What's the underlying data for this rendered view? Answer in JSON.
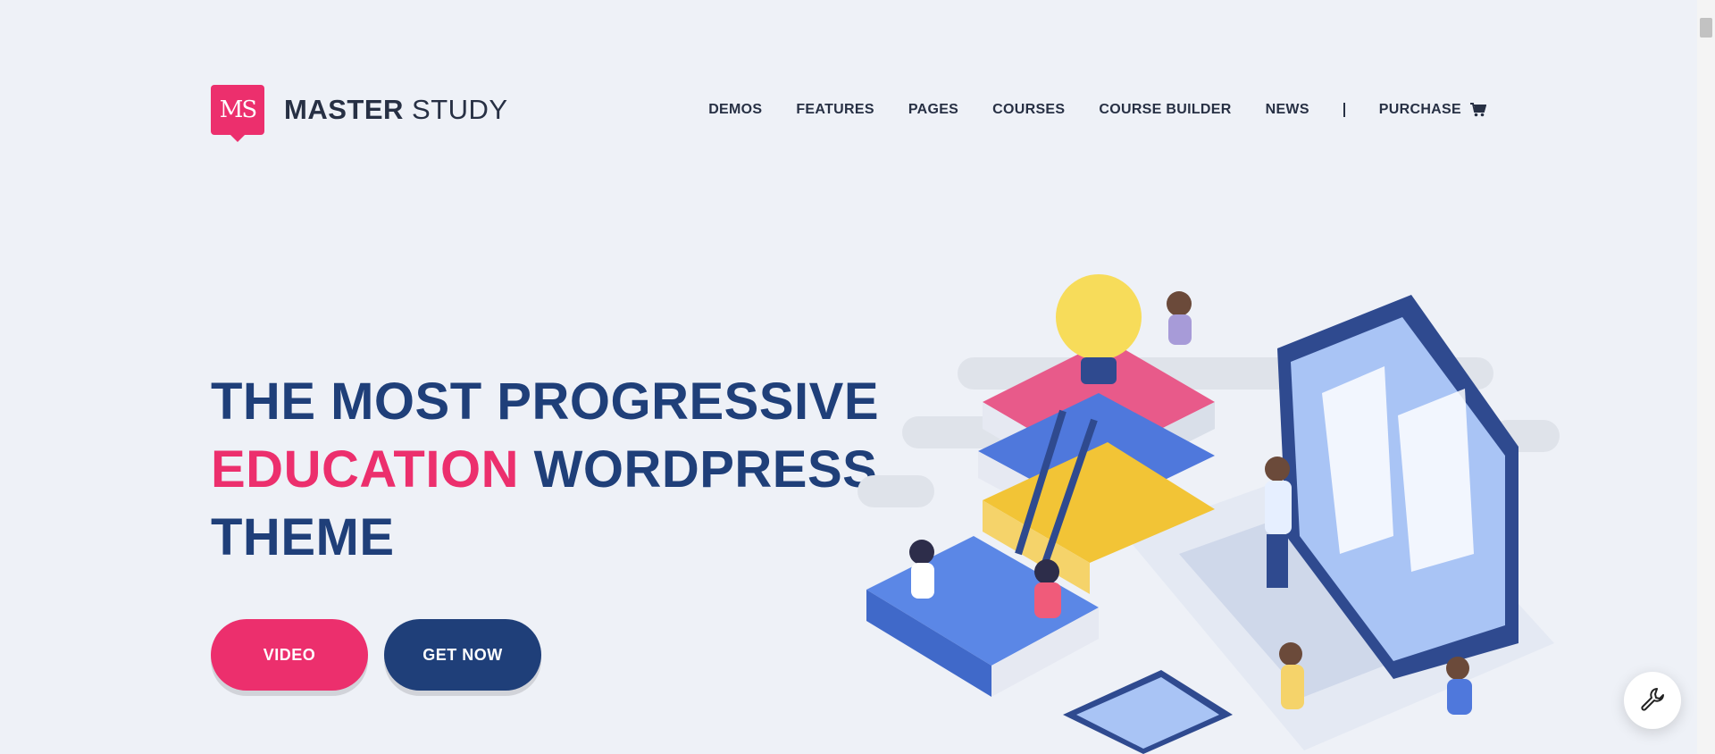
{
  "logo": {
    "mark": "MS",
    "name_bold": "MASTER",
    "name_light": "STUDY"
  },
  "nav": {
    "items": [
      "DEMOS",
      "FEATURES",
      "PAGES",
      "COURSES",
      "COURSE BUILDER",
      "NEWS"
    ],
    "purchase": "PURCHASE"
  },
  "hero": {
    "line1": "THE MOST PROGRESSIVE",
    "line2_accent": "EDUCATION",
    "line2_rest": "WORDPRESS",
    "line3": "THEME"
  },
  "buttons": {
    "video": "VIDEO",
    "get_now": "GET NOW"
  },
  "colors": {
    "accent_pink": "#ec2f6d",
    "navy": "#1f3f79",
    "background": "#eef1f7"
  },
  "icons": {
    "cart": "cart-icon",
    "tools": "wrench-icon"
  }
}
